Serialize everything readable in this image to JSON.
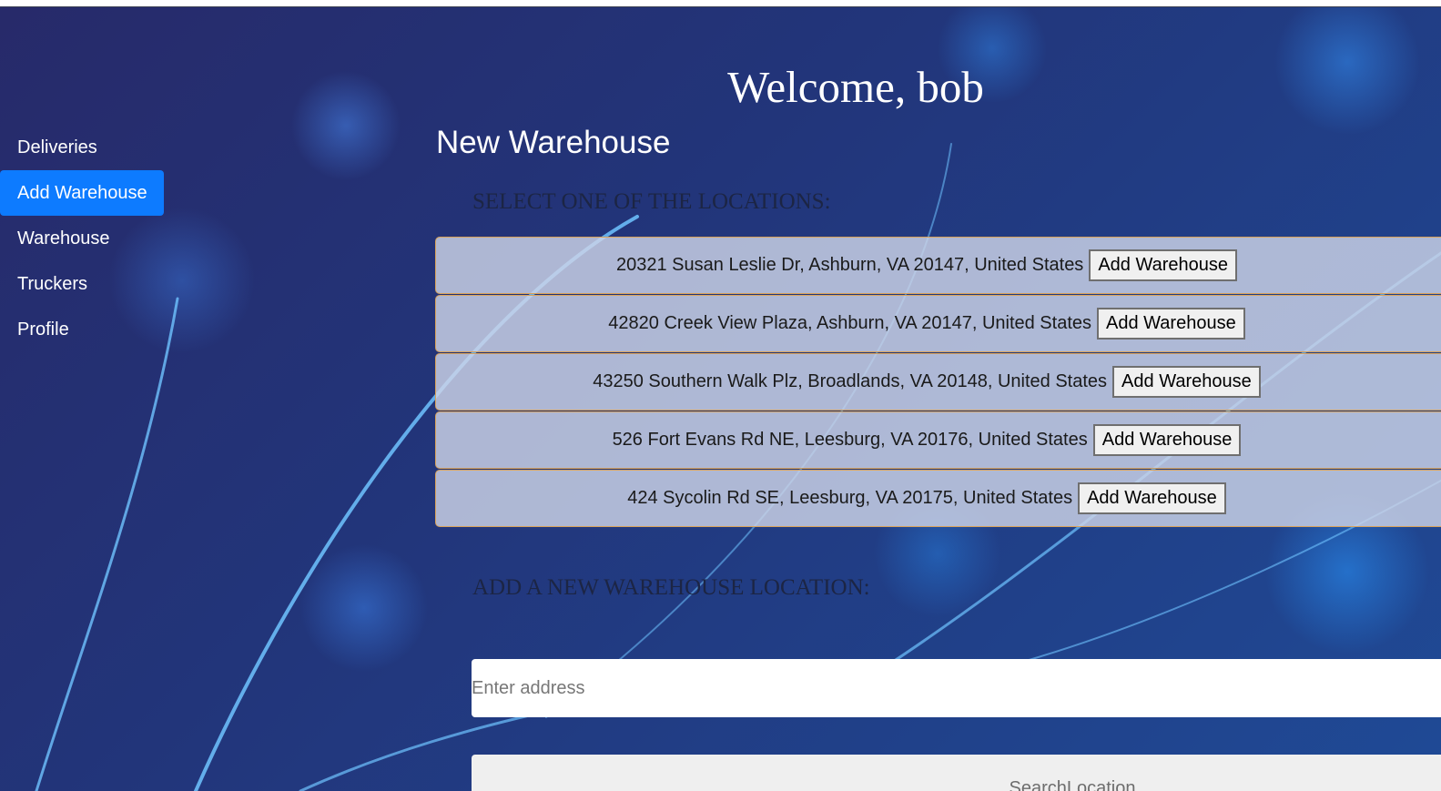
{
  "header": {
    "welcome": "Welcome, bob"
  },
  "sidebar": {
    "items": [
      {
        "label": "Deliveries"
      },
      {
        "label": "Add Warehouse",
        "active": true
      },
      {
        "label": "Warehouse"
      },
      {
        "label": "Truckers"
      },
      {
        "label": "Profile"
      }
    ],
    "active_color": "#0d7bff"
  },
  "main": {
    "title": "New Warehouse",
    "select_heading": "SELECT ONE OF THE LOCATIONS:",
    "locations": [
      {
        "address": "20321 Susan Leslie Dr, Ashburn, VA 20147, United States",
        "button": "Add Warehouse"
      },
      {
        "address": "42820 Creek View Plaza, Ashburn, VA 20147, United States",
        "button": "Add Warehouse"
      },
      {
        "address": "43250 Southern Walk Plz, Broadlands, VA 20148, United States",
        "button": "Add Warehouse"
      },
      {
        "address": "526 Fort Evans Rd NE, Leesburg, VA 20176, United States",
        "button": "Add Warehouse"
      },
      {
        "address": "424 Sycolin Rd SE, Leesburg, VA 20175, United States",
        "button": "Add Warehouse"
      }
    ],
    "add_heading": "ADD A NEW WAREHOUSE LOCATION:",
    "address_input": {
      "placeholder": "Enter address",
      "value": ""
    },
    "search_button": "SearchLocation"
  }
}
